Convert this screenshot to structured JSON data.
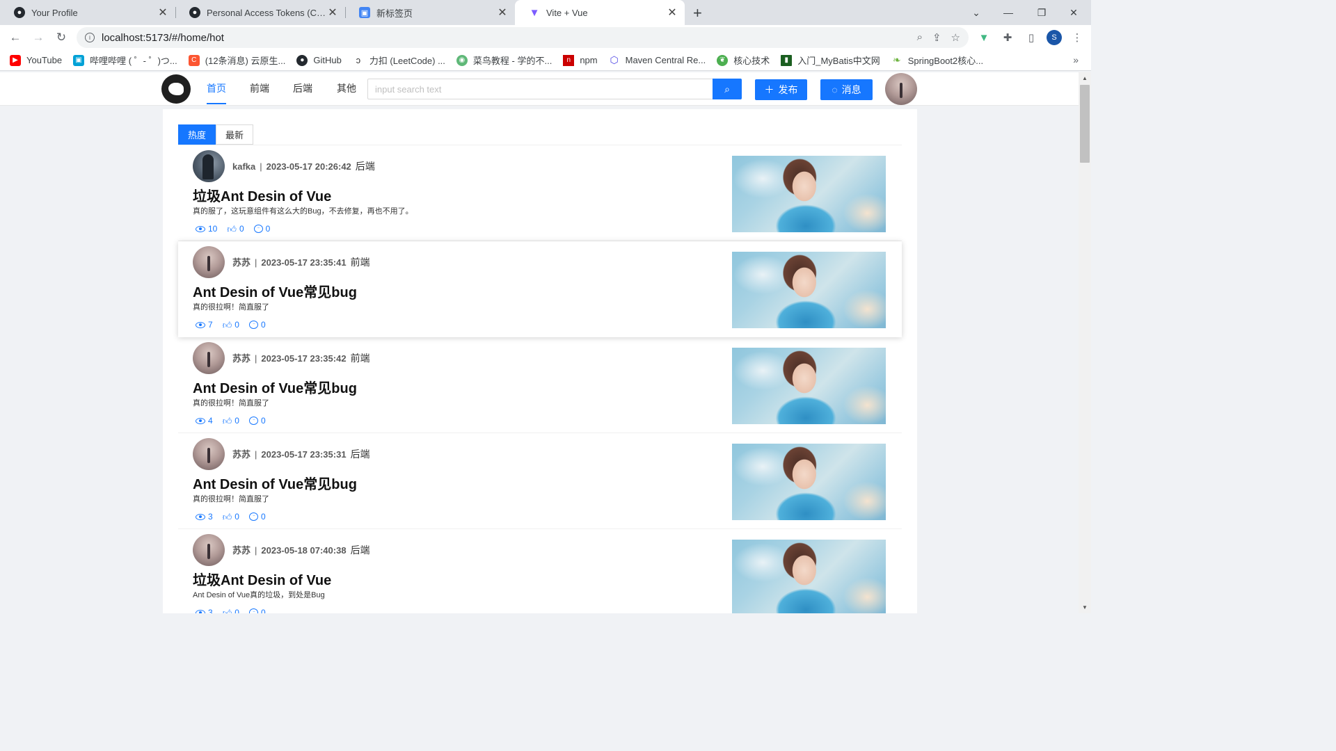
{
  "browser": {
    "tabs": [
      {
        "title": "Your Profile",
        "icon": "github-icon"
      },
      {
        "title": "Personal Access Tokens (Classic)",
        "icon": "github-icon"
      },
      {
        "title": "新标签页",
        "icon": "new-tab-icon"
      },
      {
        "title": "Vite + Vue",
        "icon": "vite-icon"
      }
    ],
    "url": "localhost:5173/#/home/hot",
    "profile_initial": "S",
    "bookmarks": [
      {
        "label": "YouTube",
        "color": "#ff0000"
      },
      {
        "label": "哔哩哔哩 ( ゜- ゜)つ...",
        "color": "#00a1d6"
      },
      {
        "label": "(12条消息) 云原生...",
        "color": "#fc5531"
      },
      {
        "label": "GitHub",
        "color": "#24292f"
      },
      {
        "label": "力扣 (LeetCode) ...",
        "color": "#333333"
      },
      {
        "label": "菜鸟教程 - 学的不...",
        "color": "#5fb878"
      },
      {
        "label": "npm",
        "color": "#cb0000"
      },
      {
        "label": "Maven Central Re...",
        "color": "#4f46e5"
      },
      {
        "label": "核心技术",
        "color": "#4caf50"
      },
      {
        "label": "入门_MyBatis中文网",
        "color": "#1b5e20"
      },
      {
        "label": "SpringBoot2核心...",
        "color": "#6db33f"
      }
    ]
  },
  "header": {
    "nav": [
      "首页",
      "前端",
      "后端",
      "其他"
    ],
    "active_nav": "首页",
    "search_placeholder": "input search text",
    "publish_label": "发布",
    "message_label": "消息",
    "accent": "#1677ff"
  },
  "tabs": [
    "热度",
    "最新"
  ],
  "active_tab": "热度",
  "articles": [
    {
      "author": "kafka",
      "time": "2023-05-17 20:26:42",
      "category": "后端",
      "title": "垃圾Ant Desin of Vue",
      "desc": "真的服了，这玩意组件有这么大的Bug，不去修复，再也不用了。",
      "views": "10",
      "likes": "0",
      "comments": "0"
    },
    {
      "author": "苏苏",
      "time": "2023-05-17 23:35:41",
      "category": "前端",
      "title": "Ant Desin of Vue常见bug",
      "desc": "真的很拉啊！简直服了",
      "views": "7",
      "likes": "0",
      "comments": "0"
    },
    {
      "author": "苏苏",
      "time": "2023-05-17 23:35:42",
      "category": "前端",
      "title": "Ant Desin of Vue常见bug",
      "desc": "真的很拉啊！简直服了",
      "views": "4",
      "likes": "0",
      "comments": "0"
    },
    {
      "author": "苏苏",
      "time": "2023-05-17 23:35:31",
      "category": "后端",
      "title": "Ant Desin of Vue常见bug",
      "desc": "真的很拉啊！简直服了",
      "views": "3",
      "likes": "0",
      "comments": "0"
    },
    {
      "author": "苏苏",
      "time": "2023-05-18 07:40:38",
      "category": "后端",
      "title": "垃圾Ant Desin of Vue",
      "desc": "Ant Desin of Vue真的垃圾，到处是Bug",
      "views": "3",
      "likes": "0",
      "comments": "0"
    }
  ]
}
